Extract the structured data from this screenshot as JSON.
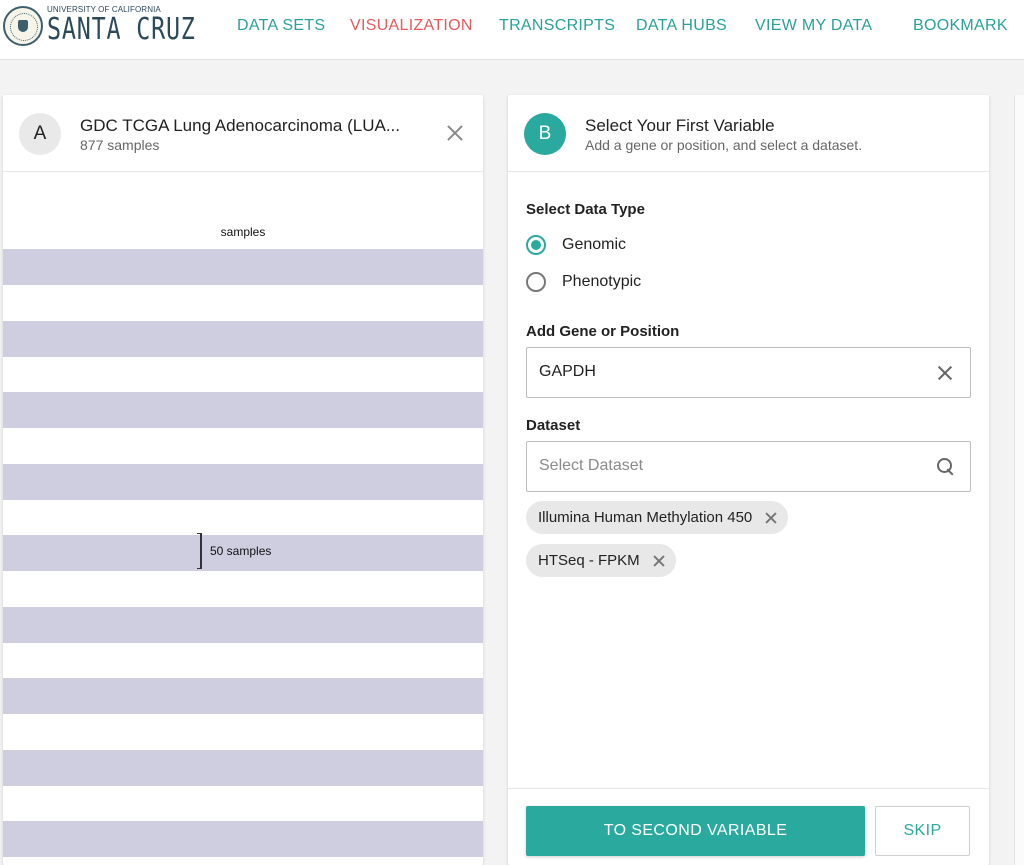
{
  "logo": {
    "top_text": "UNIVERSITY OF CALIFORNIA",
    "main_text": "SANTA CRUZ"
  },
  "nav": {
    "items": [
      "DATA SETS",
      "VISUALIZATION",
      "TRANSCRIPTS",
      "DATA HUBS",
      "VIEW MY DATA",
      "BOOKMARK"
    ],
    "active": "VISUALIZATION"
  },
  "column_a": {
    "badge": "A",
    "title": "GDC TCGA Lung Adenocarcinoma (LUA...",
    "subtitle": "877 samples",
    "samples_label": "samples",
    "bracket_label": "50 samples"
  },
  "column_b": {
    "badge": "B",
    "title": "Select Your First Variable",
    "subtitle": "Add a gene or position, and select a dataset.",
    "data_type": {
      "label": "Select Data Type",
      "options": [
        "Genomic",
        "Phenotypic"
      ],
      "selected": "Genomic"
    },
    "gene": {
      "label": "Add Gene or Position",
      "value": "GAPDH"
    },
    "dataset": {
      "label": "Dataset",
      "placeholder": "Select Dataset",
      "chips": [
        "Illumina Human Methylation 450",
        "HTSeq - FPKM"
      ]
    },
    "buttons": {
      "primary": "TO SECOND VARIABLE",
      "secondary": "SKIP"
    }
  },
  "colors": {
    "accent": "#2aaa9e",
    "active_nav": "#e65b5b",
    "stripe": "#cfcde0"
  }
}
